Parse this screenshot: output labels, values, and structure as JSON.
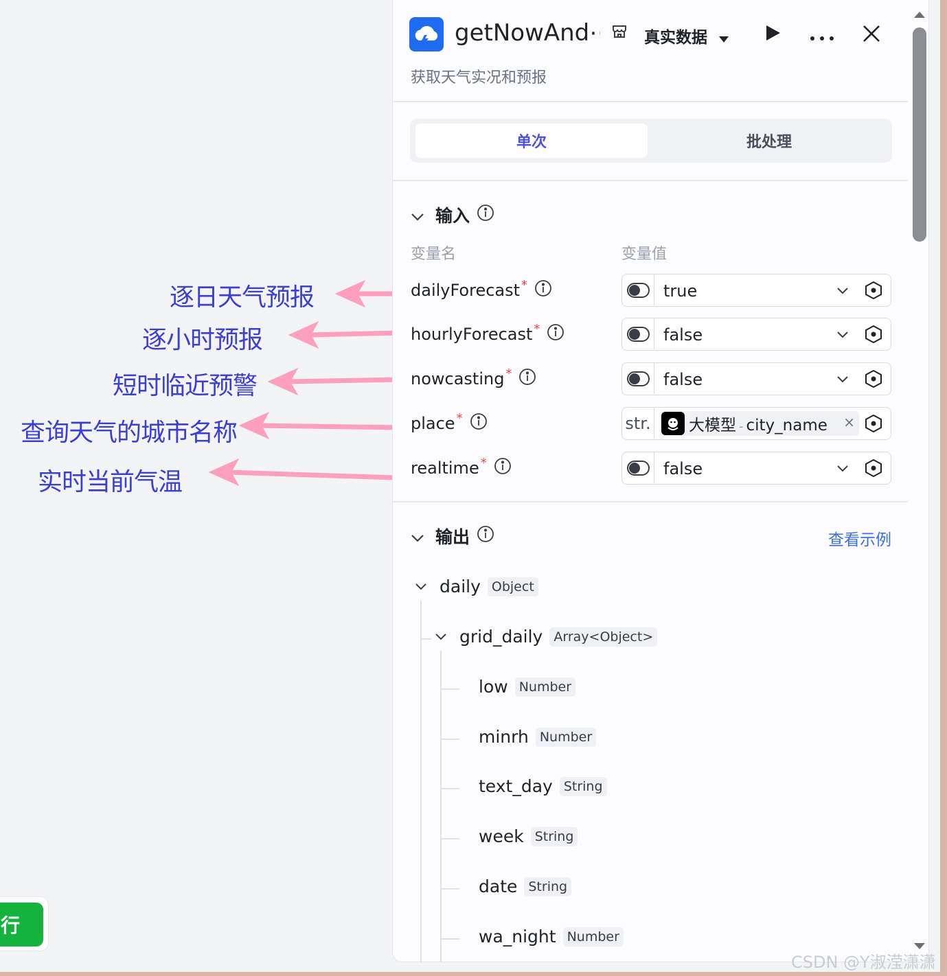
{
  "annotations": [
    "逐日天气预报",
    "逐小时预报",
    "短时临近预警",
    "查询天气的城市名称",
    "实时当前气温"
  ],
  "run_button": {
    "label": "行"
  },
  "panel": {
    "title": "getNowAnd⋯",
    "data_mode": "真实数据",
    "subtitle": "获取天气实况和预报",
    "tabs": [
      {
        "label": "单次",
        "active": true
      },
      {
        "label": "批处理",
        "active": false
      }
    ],
    "inputs": {
      "title": "输入",
      "col_name": "变量名",
      "col_value": "变量值",
      "params": [
        {
          "name": "dailyForecast",
          "required": "*",
          "value": "true"
        },
        {
          "name": "hourlyForecast",
          "required": "*",
          "value": "false"
        },
        {
          "name": "nowcasting",
          "required": "*",
          "value": "false"
        },
        {
          "name": "place",
          "required": "*",
          "type_label": "str.",
          "ref_source": "大模型",
          "ref_sep": "-",
          "ref_field": "city_name",
          "ref_remove": "×"
        },
        {
          "name": "realtime",
          "required": "*",
          "value": "false"
        }
      ]
    },
    "outputs": {
      "title": "输出",
      "example_link": "查看示例",
      "tree": [
        {
          "name": "daily",
          "type": "Object"
        },
        {
          "name": "grid_daily",
          "type": "Array<Object>"
        },
        {
          "name": "low",
          "type": "Number"
        },
        {
          "name": "minrh",
          "type": "Number"
        },
        {
          "name": "text_day",
          "type": "String"
        },
        {
          "name": "week",
          "type": "String"
        },
        {
          "name": "date",
          "type": "String"
        },
        {
          "name": "wa_night",
          "type": "Number"
        }
      ]
    }
  },
  "watermark": "CSDN @Y淑滢潇潇",
  "colors": {
    "accent": "#4b4fe6",
    "annotation": "#3b3fd4",
    "arrow": "#ff9fbf",
    "run_green": "#14b33c",
    "logo_blue": "#1e6cf2",
    "required": "#ef4444",
    "link": "#3b6fe6"
  }
}
